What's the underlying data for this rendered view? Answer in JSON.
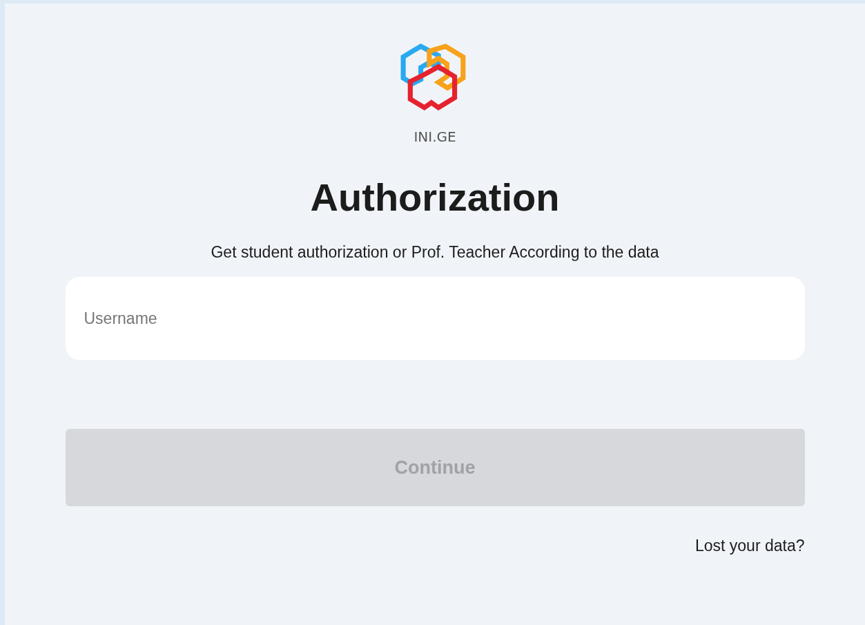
{
  "logo": {
    "text": "INI.GE"
  },
  "title": "Authorization",
  "subtitle": "Get student authorization or Prof. Teacher According to the data",
  "username": {
    "placeholder": "Username"
  },
  "continue_button": {
    "label": "Continue",
    "disabled": true
  },
  "lost_data_link": "Lost your data?"
}
